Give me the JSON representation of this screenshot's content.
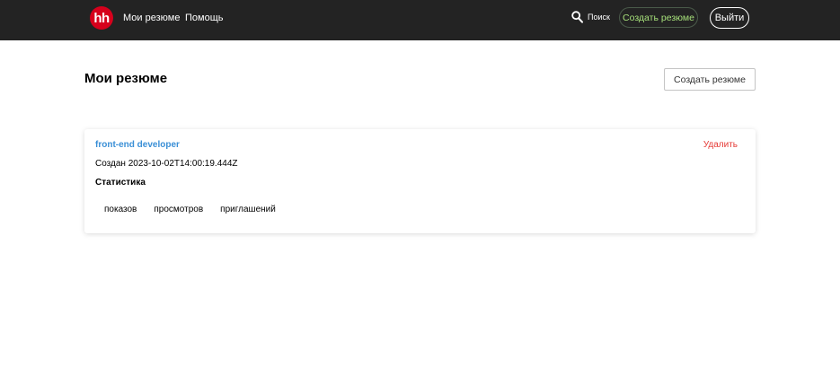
{
  "header": {
    "logo_text": "hh",
    "nav": {
      "my_resumes": "Мои резюме",
      "help": "Помощь"
    },
    "search_label": "Поиск",
    "create_resume": "Создать резюме",
    "logout": "Выйти",
    "colors": {
      "background": "#232323",
      "logo": "#d6001c",
      "create_accent": "#a6e07a"
    }
  },
  "main": {
    "title": "Мои резюме",
    "create_button": "Создать резюме",
    "resumes": [
      {
        "title": "front-end developer",
        "delete_label": "Удалить",
        "created": "Создан 2023-10-02T14:00:19.444Z",
        "stats_heading": "Статистика",
        "stats": [
          "показов",
          "просмотров",
          "приглашений"
        ]
      }
    ],
    "colors": {
      "link": "#3a8fd6",
      "delete": "#e53935"
    }
  }
}
